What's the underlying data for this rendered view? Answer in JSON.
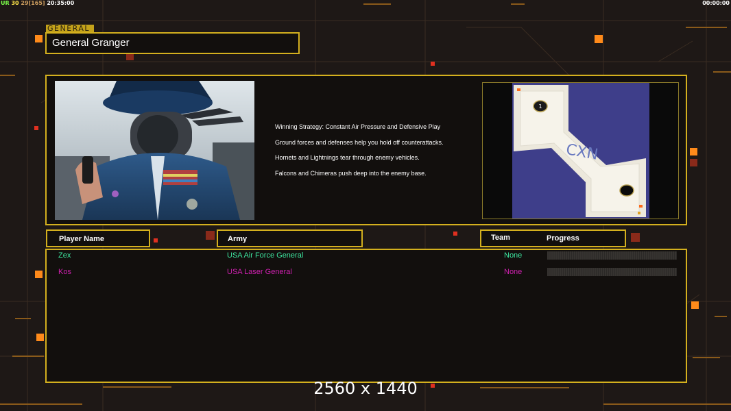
{
  "hud": {
    "ur_label": "UR",
    "fps": "30",
    "frames": "29[165]",
    "clock": "20:35:00",
    "timer": "00:00:00"
  },
  "general": {
    "tag": "GENERAL",
    "name": "General Granger"
  },
  "strategy": [
    "Winning Strategy: Constant Air Pressure and Defensive Play",
    "Ground forces and defenses help you hold off counterattacks.",
    "Hornets and Lightnings tear through enemy vehicles.",
    "Falcons and Chimeras push deep into the enemy base."
  ],
  "map": {
    "logo": "CXN",
    "start_1_label": "1"
  },
  "table": {
    "headers": {
      "player_name": "Player Name",
      "army": "Army",
      "team": "Team",
      "progress": "Progress"
    },
    "rows": [
      {
        "player": "Zex",
        "army": "USA Air Force General",
        "team": "None",
        "color": "#3ee6a0"
      },
      {
        "player": "Kos",
        "army": "USA Laser General",
        "team": "None",
        "color": "#d020b0"
      }
    ]
  },
  "resolution_label": "2560 x 1440",
  "colors": {
    "gold": "#d4b01e",
    "accent_orange": "#ff8a1a"
  }
}
